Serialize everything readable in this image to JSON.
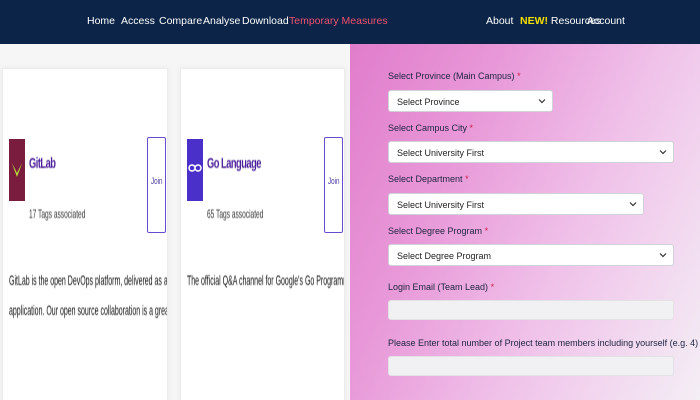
{
  "nav": {
    "home": "Home",
    "access": "Access",
    "compare": "Compare",
    "analyse": "Analyse",
    "download": "Download",
    "temporary": "Temporary Measures",
    "about": "About",
    "new_badge": "NEW!",
    "resources": "Resources",
    "account": "Account"
  },
  "cards": [
    {
      "title": "GitLab",
      "tags": "17 Tags associated",
      "join": "Join",
      "desc_line1": "GitLab is the open DevOps platform, delivered as a single",
      "desc_line2": "application. Our open source collaboration is a great place to sha...",
      "logo_colors": [
        "#7a1c3e",
        "#b8d93a"
      ]
    },
    {
      "title": "Go Language",
      "tags": "65 Tags associated",
      "join": "Join",
      "desc_line1": "The official Q&A channel for Google's Go Programming Language.",
      "logo_colors": [
        "#4b2fc9",
        "#ffffff"
      ]
    }
  ],
  "form": {
    "province_label": "Select Province (Main Campus)",
    "province_value": "Select Province",
    "city_label": "Select Campus City",
    "city_value": "Select University First",
    "department_label": "Select Department",
    "department_value": "Select University First",
    "degree_label": "Select Degree Program",
    "degree_value": "Select Degree Program",
    "email_label": "Login Email (Team Lead)",
    "email_value": "",
    "members_label": "Please Enter total number of Project team members including yourself (e.g. 4)",
    "members_value": "",
    "required_mark": "*"
  }
}
